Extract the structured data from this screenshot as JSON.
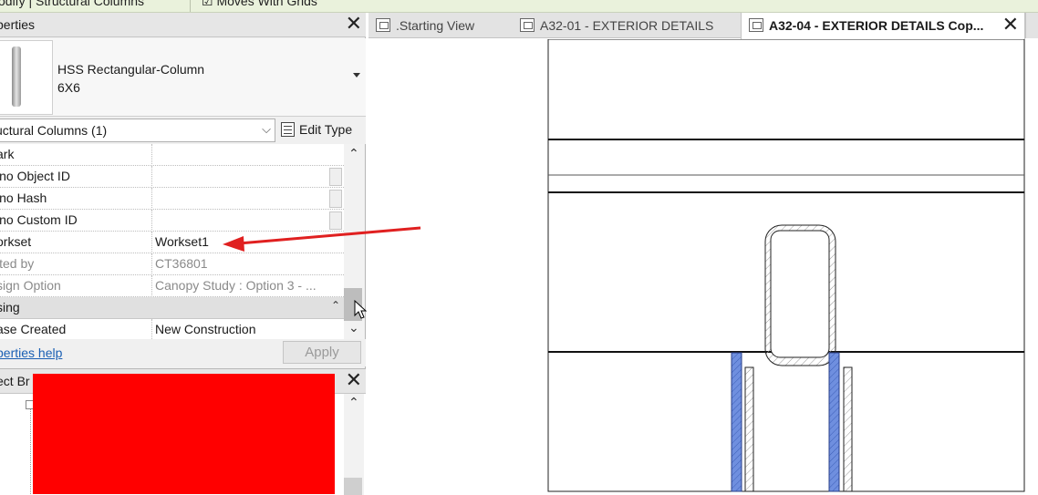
{
  "ribbon": {
    "context_label": "odify | Structural Columns",
    "option_label": "Moves With Grids"
  },
  "properties": {
    "title": "perties",
    "type_name": "HSS Rectangular-Column",
    "type_size": "6X6",
    "filter": "uctural Columns (1)",
    "edit_type": "Edit Type",
    "rows": [
      {
        "key": "ark",
        "value": "",
        "style": "normal"
      },
      {
        "key": "ino Object ID",
        "value": "",
        "style": "locked"
      },
      {
        "key": "ino Hash",
        "value": "",
        "style": "locked"
      },
      {
        "key": "ino Custom ID",
        "value": "",
        "style": "locked"
      },
      {
        "key": "orkset",
        "value": "Workset1",
        "style": "normal"
      },
      {
        "key": "ited by",
        "value": "CT36801",
        "style": "dim"
      },
      {
        "key": "sign Option",
        "value": "Canopy Study : Option 3 - ...",
        "style": "dim"
      },
      {
        "key": "sing",
        "value": "",
        "style": "group"
      },
      {
        "key": "ase Created",
        "value": "New Construction",
        "style": "normal"
      }
    ],
    "help_link": "perties help",
    "apply_label": "Apply"
  },
  "project_browser": {
    "title": "ect Br"
  },
  "tabs": [
    {
      "label": ".Starting View",
      "active": false
    },
    {
      "label": "A32-01 - EXTERIOR DETAILS",
      "active": false
    },
    {
      "label": "A32-04 - EXTERIOR DETAILS Cop...",
      "active": true
    }
  ],
  "colors": {
    "annotation_arrow": "#e02020",
    "redaction": "#ff0000",
    "hatch_fill": "#6f8fdf",
    "link": "#1a5fb4"
  },
  "icons": [
    "close-icon",
    "dropdown-arrow-icon",
    "edit-type-icon",
    "scroll-up-icon",
    "scroll-down-icon",
    "collapse-icon",
    "view-icon",
    "sheet-icon",
    "mouse-cursor-icon"
  ]
}
